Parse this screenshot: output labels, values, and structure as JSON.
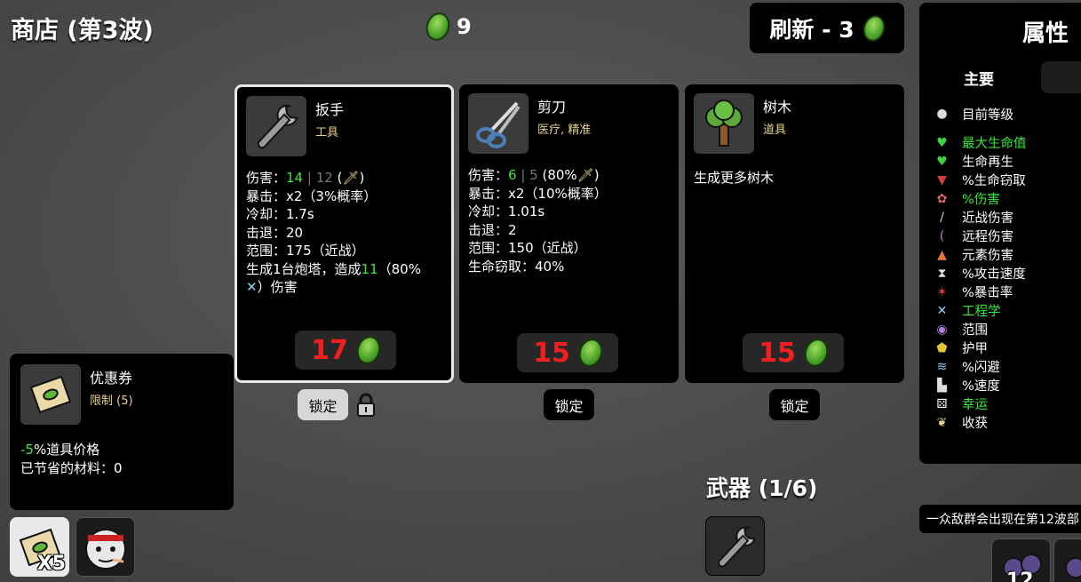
{
  "header": {
    "shop_title": "商店 (第3波)",
    "materials": "9",
    "refresh_label": "刷新 - 3"
  },
  "shop_items": [
    {
      "name": "扳手",
      "tag": "工具",
      "icon": "wrench-icon",
      "stats": {
        "damage_label": "伤害：",
        "damage_value": "14",
        "damage_sep": " | ",
        "damage_base": "12",
        "damage_scaling": " (",
        "damage_close": ")",
        "crit": "暴击：x2（3%概率）",
        "cooldown": "冷却：1.7s",
        "knockback": "击退：20",
        "range": "范围：175（近战）"
      },
      "desc_prefix": "生成1台炮塔，造成",
      "desc_value": "11",
      "desc_mid": "（80%",
      "desc_suffix": "）伤害",
      "price": "17",
      "lock_label": "锁定"
    },
    {
      "name": "剪刀",
      "tag": "医疗, 精准",
      "icon": "scissors-icon",
      "stats": {
        "damage_label": "伤害：",
        "damage_value": "6",
        "damage_sep": " | ",
        "damage_base": "5",
        "damage_scaling": " (80%",
        "damage_close": ")",
        "crit": "暴击：x2（10%概率）",
        "cooldown": "冷却：1.01s",
        "knockback": "击退：2",
        "range": "范围：150（近战）",
        "lifesteal": "生命窃取：40%"
      },
      "price": "15",
      "lock_label": "锁定"
    },
    {
      "name": "树木",
      "tag": "道具",
      "icon": "tree-icon",
      "desc": "生成更多树木",
      "price": "15",
      "lock_label": "锁定"
    }
  ],
  "coupon": {
    "name": "优惠券",
    "limit": "限制 (5)",
    "effect_value": "-5",
    "effect_text": "%道具价格",
    "saved": "已节省的材料：0"
  },
  "inventory": {
    "coupon_count": "X5"
  },
  "weapons": {
    "title": "武器 (1/6)"
  },
  "stats_panel": {
    "title": "属性",
    "tab_main": "主要",
    "rows": [
      {
        "label": "目前等级",
        "icon": "level-icon",
        "color": "#ffffff"
      },
      {
        "label": "最大生命值",
        "icon": "heart-icon",
        "color": "#38e838"
      },
      {
        "label": "生命再生",
        "icon": "heart-regen-icon",
        "color": "#ffffff"
      },
      {
        "label": "%生命窃取",
        "icon": "fangs-icon",
        "color": "#ffffff"
      },
      {
        "label": "%伤害",
        "icon": "brain-icon",
        "color": "#38e838"
      },
      {
        "label": "近战伤害",
        "icon": "sword-icon",
        "color": "#ffffff"
      },
      {
        "label": "远程伤害",
        "icon": "bow-icon",
        "color": "#ffffff"
      },
      {
        "label": "元素伤害",
        "icon": "flame-icon",
        "color": "#ffffff"
      },
      {
        "label": "%攻击速度",
        "icon": "hourglass-icon",
        "color": "#ffffff"
      },
      {
        "label": "%暴击率",
        "icon": "crit-icon",
        "color": "#ffffff"
      },
      {
        "label": "工程学",
        "icon": "engineering-icon",
        "color": "#38e838"
      },
      {
        "label": "范围",
        "icon": "range-icon",
        "color": "#ffffff"
      },
      {
        "label": "护甲",
        "icon": "shield-icon",
        "color": "#ffffff"
      },
      {
        "label": "%闪避",
        "icon": "dodge-icon",
        "color": "#ffffff"
      },
      {
        "label": "%速度",
        "icon": "boot-icon",
        "color": "#ffffff"
      },
      {
        "label": "幸运",
        "icon": "dice-icon",
        "color": "#38e838"
      },
      {
        "label": "收获",
        "icon": "harvest-icon",
        "color": "#ffffff"
      }
    ]
  },
  "wave_notice": "一众敌群会出现在第12波部",
  "enemy_count": "12",
  "colors": {
    "positive": "#38e838",
    "price": "#f02020",
    "tag": "#e9d28b"
  }
}
